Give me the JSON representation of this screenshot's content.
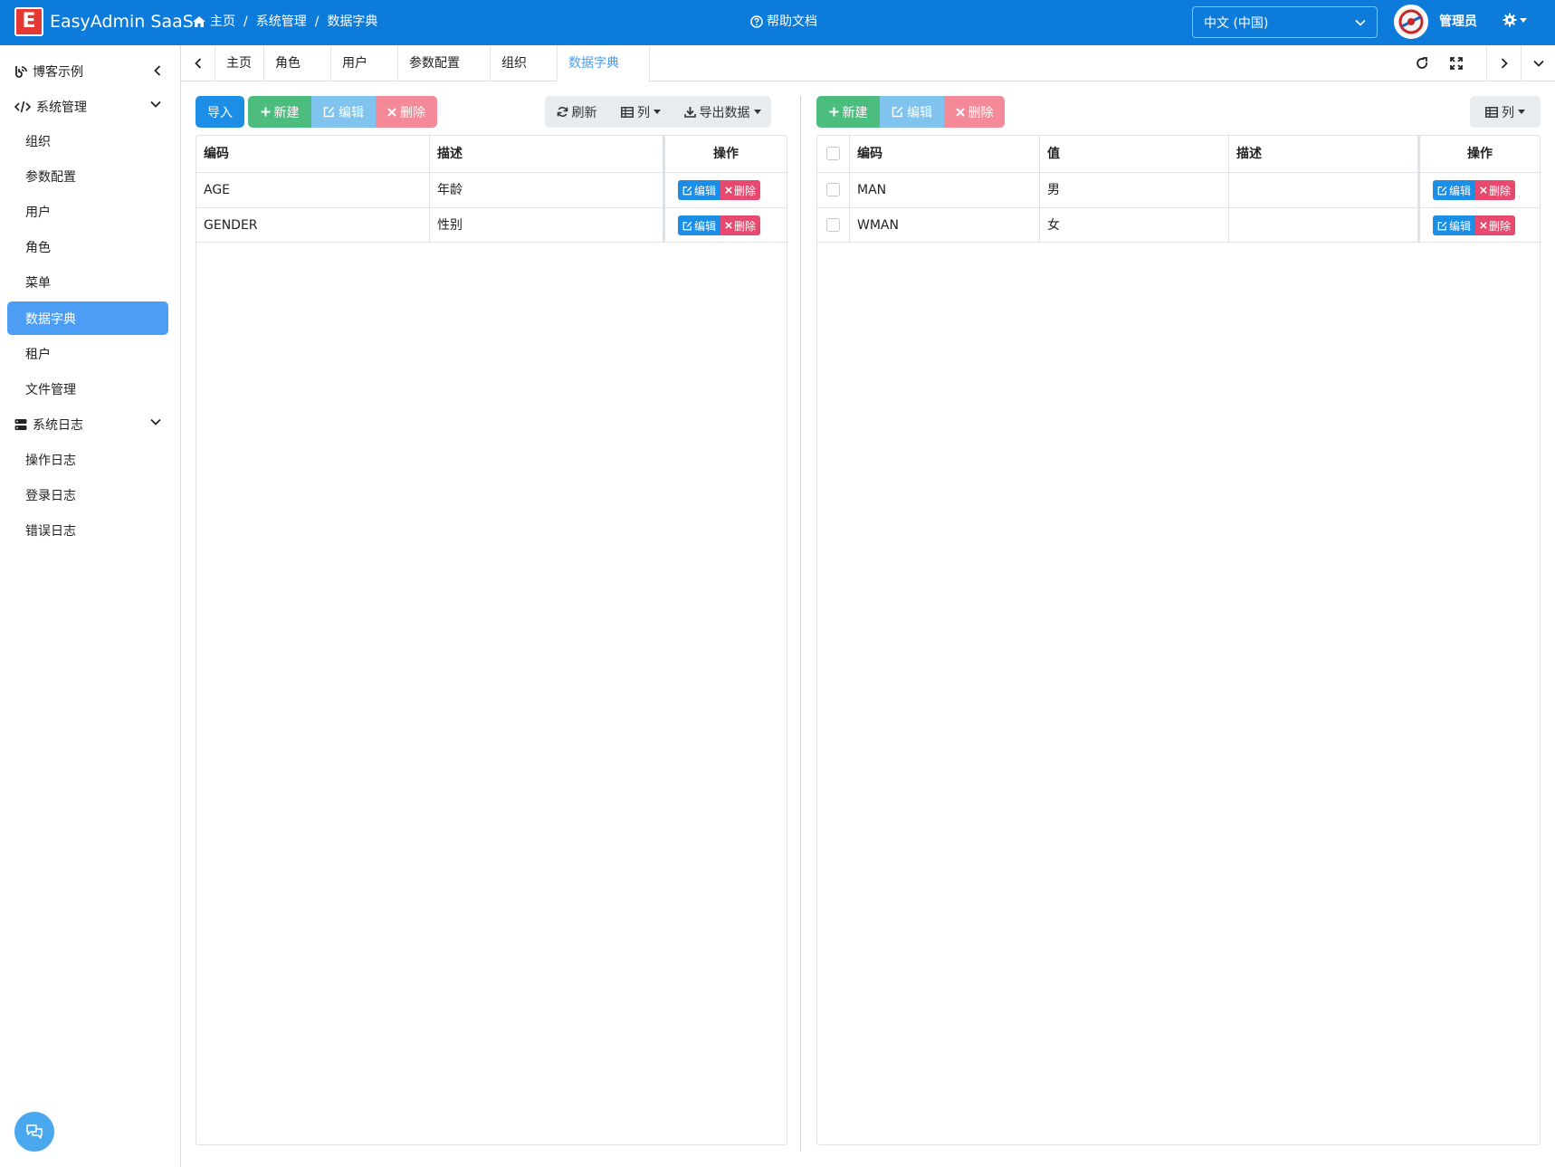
{
  "header": {
    "logo_letter": "E",
    "app_title": "EasyAdmin SaaS",
    "breadcrumb": [
      "主页",
      "系统管理",
      "数据字典"
    ],
    "help_label": "帮助文档",
    "language": "中文 (中国)",
    "user_name": "管理员"
  },
  "sidebar": {
    "groups": [
      {
        "label": "博客示例"
      },
      {
        "label": "系统管理"
      },
      {
        "label": "系统日志"
      }
    ],
    "system_items": [
      "组织",
      "参数配置",
      "用户",
      "角色",
      "菜单",
      "数据字典",
      "租户",
      "文件管理"
    ],
    "log_items": [
      "操作日志",
      "登录日志",
      "错误日志"
    ],
    "active_item": "数据字典"
  },
  "tabs": [
    "主页",
    "角色",
    "用户",
    "参数配置",
    "组织",
    "数据字典"
  ],
  "active_tab": "数据字典",
  "left_panel": {
    "toolbar": {
      "import": "导入",
      "new": "新建",
      "edit": "编辑",
      "delete": "删除",
      "refresh": "刷新",
      "columns": "列",
      "export": "导出数据"
    },
    "columns": [
      "编码",
      "描述",
      "操作"
    ],
    "rows": [
      {
        "code": "AGE",
        "desc": "年龄"
      },
      {
        "code": "GENDER",
        "desc": "性别"
      }
    ],
    "row_actions": {
      "edit": "编辑",
      "delete": "删除"
    }
  },
  "right_panel": {
    "toolbar": {
      "new": "新建",
      "edit": "编辑",
      "delete": "删除",
      "columns": "列"
    },
    "columns": [
      "编码",
      "值",
      "描述",
      "操作"
    ],
    "rows": [
      {
        "code": "MAN",
        "value": "男",
        "desc": ""
      },
      {
        "code": "WMAN",
        "value": "女",
        "desc": ""
      }
    ],
    "row_actions": {
      "edit": "编辑",
      "delete": "删除"
    }
  },
  "colors": {
    "header_bg": "#0c7bd9",
    "active_menu": "#4c9ef5",
    "primary": "#1d8ee6",
    "success": "#4cbd7e",
    "info": "#7fc3ee",
    "danger_light": "#f48998",
    "danger": "#e84a6f"
  }
}
